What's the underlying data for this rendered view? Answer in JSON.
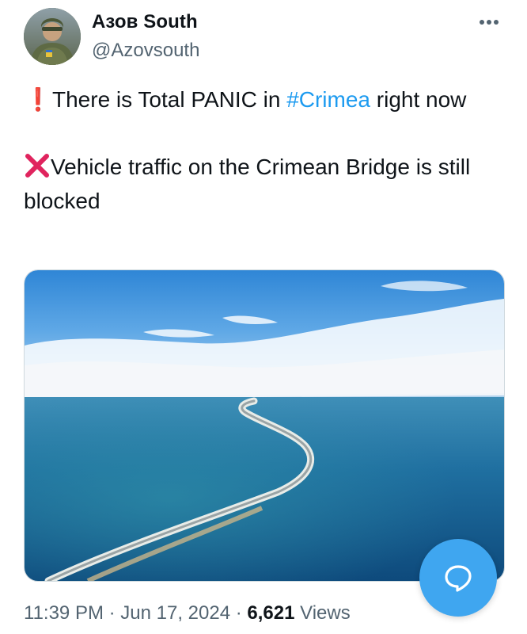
{
  "author": {
    "display_name": "Азов South",
    "handle": "@Azovsouth"
  },
  "tweet": {
    "line1_emoji": "❗",
    "line1_before": "There is Total PANIC in ",
    "line1_hashtag": "#Crimea",
    "line1_after": " right now",
    "line2_emoji": "❌",
    "line2_text": "Vehicle traffic on the Crimean Bridge is still blocked"
  },
  "meta": {
    "time": "11:39 PM",
    "separator": " · ",
    "date": "Jun 17, 2024",
    "views_count": "6,621",
    "views_label": " Views"
  },
  "icons": {
    "more": "more-horizontal-icon",
    "fab": "reply-bubble-icon"
  },
  "colors": {
    "hashtag": "#1d9bf0",
    "secondary_text": "#536471",
    "fab": "#3fa6f0",
    "exclaim": "#e0245e"
  }
}
